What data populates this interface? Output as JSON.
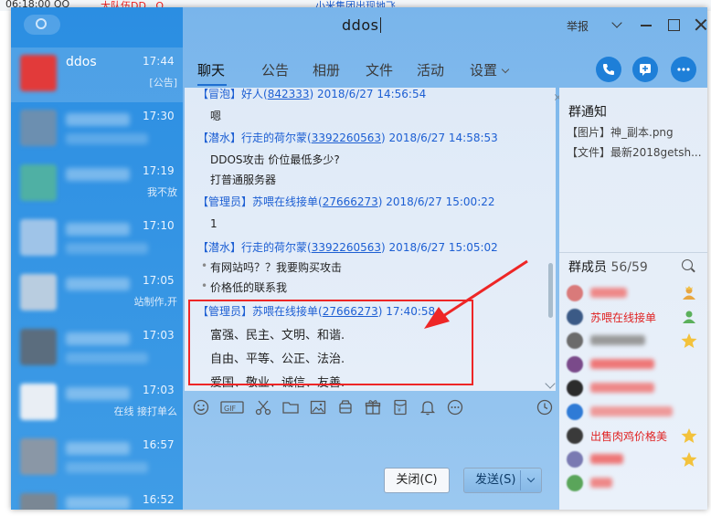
{
  "background_strip": {
    "fragments": [
      "06:18:00 QQ",
      "大队伍DD...O",
      "小米集团出现地飞"
    ]
  },
  "window": {
    "title": "ddos",
    "report_label": "举报",
    "accent_color": "#1e7fd8"
  },
  "contacts": [
    {
      "name": "ddos",
      "time": "17:44",
      "snippet": "[公告]",
      "active": true
    },
    {
      "name": "",
      "time": "17:30",
      "snippet": ""
    },
    {
      "name": "",
      "time": "17:19",
      "snippet": "我不放"
    },
    {
      "name": "",
      "time": "17:10",
      "snippet": ""
    },
    {
      "name": "",
      "time": "17:05",
      "snippet": "站制作,开"
    },
    {
      "name": "",
      "time": "17:03",
      "snippet": ""
    },
    {
      "name": "",
      "time": "17:03",
      "snippet": "在线 接打单么"
    },
    {
      "name": "",
      "time": "16:57",
      "snippet": ""
    },
    {
      "name": "",
      "time": "16:52",
      "snippet": ""
    }
  ],
  "tabs": [
    "聊天",
    "公告",
    "相册",
    "文件",
    "活动",
    "设置"
  ],
  "header_icons": [
    "phone-icon",
    "add-icon",
    "more-icon"
  ],
  "messages": [
    {
      "header_prefix": "【冒泡】好人(",
      "qq": "842333",
      "header_suffix": ") 2018/6/27 14:56:54",
      "lines": [
        "嗯"
      ]
    },
    {
      "header_prefix": "【潜水】行走的荷尔蒙(",
      "qq": "3392260563",
      "header_suffix": ") 2018/6/27 14:58:53",
      "lines": [
        "DDOS攻击  价位最低多少?",
        "打普通服务器"
      ]
    },
    {
      "header_prefix": "【管理员】苏喂在线接单(",
      "qq": "27666273",
      "header_suffix": ") 2018/6/27 15:00:22",
      "lines": [
        "1"
      ]
    },
    {
      "header_prefix": "【潜水】行走的荷尔蒙(",
      "qq": "3392260563",
      "header_suffix": ") 2018/6/27 15:05:02",
      "lines": [
        "有网站吗？？我要购买攻击",
        "价格低的联系我"
      ]
    },
    {
      "header_prefix": "【管理员】苏喂在线接单(",
      "qq": "27666273",
      "header_suffix": ")    17:40:58",
      "lines": [
        "富强、民主、文明、和谐.",
        "自由、平等、公正、法治.",
        "爱国、敬业、诚信、友善."
      ]
    }
  ],
  "toolbar_icons": [
    "emoji-icon",
    "gif-icon",
    "scissors-icon",
    "folder-icon",
    "image-icon",
    "shake-icon",
    "gift-icon",
    "red-packet-icon",
    "bell-icon",
    "more-circle-icon",
    "history-icon"
  ],
  "buttons": {
    "close_label": "关闭(C)",
    "send_label": "发送(S)"
  },
  "right_panel": {
    "notice_title": "群通知",
    "notices": [
      "【图片】神_副本.png",
      "【文件】最新2018getsh..."
    ],
    "members_title": "群成员",
    "members_count": "56/59",
    "members": [
      {
        "name": "",
        "badge": "owner-icon",
        "avatar_color": "#d97a7a"
      },
      {
        "name": "苏喂在线接单",
        "badge": "admin-icon",
        "avatar_color": "#3b5a86"
      },
      {
        "name": "",
        "badge": "star-icon",
        "avatar_color": "#6b6b6b"
      },
      {
        "name": "",
        "badge": "",
        "avatar_color": "#7a4a8a"
      },
      {
        "name": "",
        "badge": "",
        "avatar_color": "#2b2b2b"
      },
      {
        "name": "",
        "badge": "",
        "avatar_color": "#2f7bd6"
      },
      {
        "name": "出售肉鸡价格美",
        "badge": "star-icon",
        "avatar_color": "#3a3a3a"
      },
      {
        "name": "",
        "badge": "star-icon",
        "avatar_color": "#7a7ab2"
      },
      {
        "name": "",
        "badge": "",
        "avatar_color": "#5aa55a"
      }
    ]
  }
}
